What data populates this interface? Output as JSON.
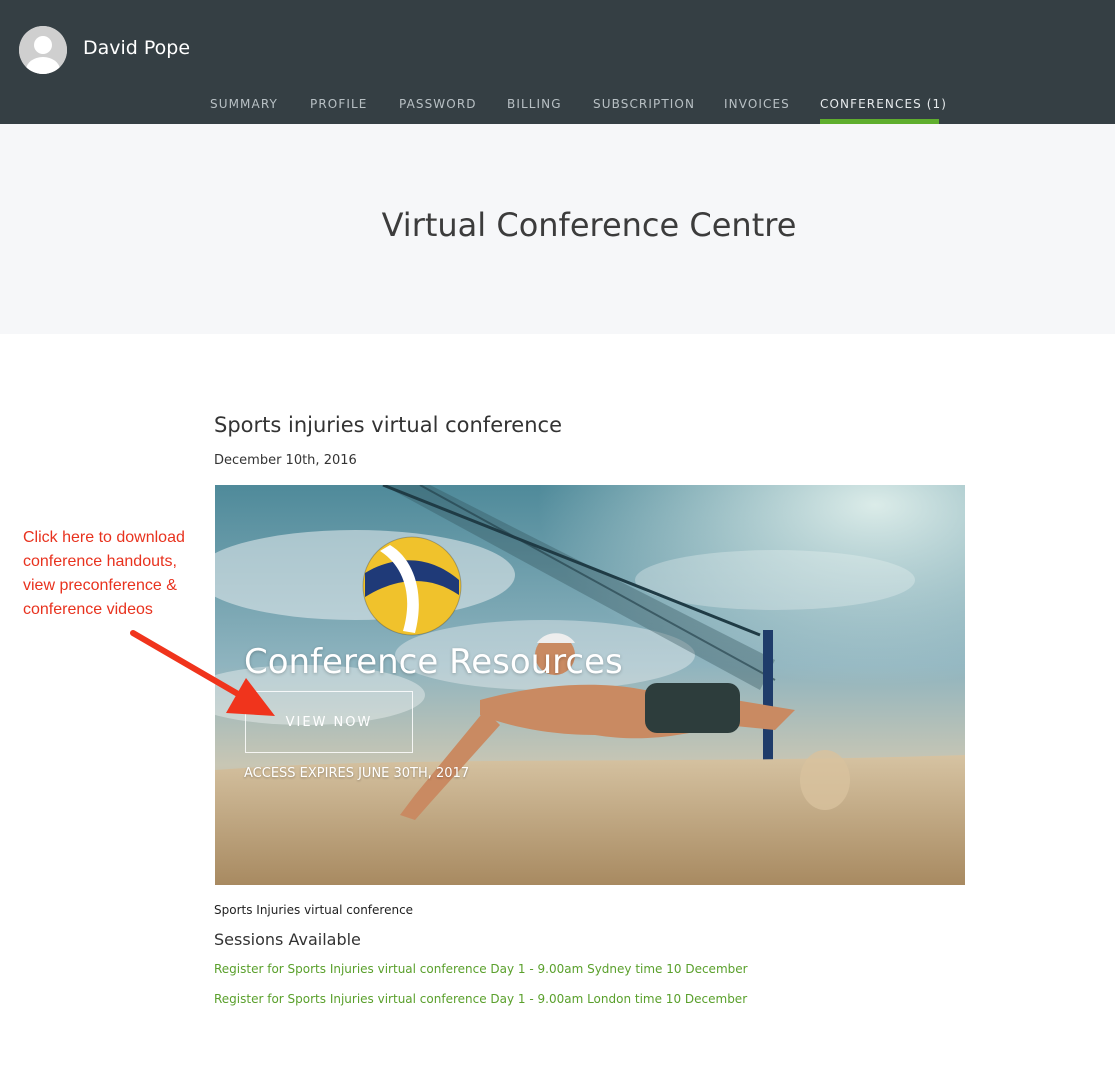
{
  "header": {
    "user_name": "David Pope",
    "avatar_icon": "user-avatar-icon",
    "bg_color": "#353f44",
    "accent_color": "#5fae2e",
    "nav": [
      {
        "label": "SUMMARY",
        "active": false
      },
      {
        "label": "PROFILE",
        "active": false
      },
      {
        "label": "PASSWORD",
        "active": false
      },
      {
        "label": "BILLING",
        "active": false
      },
      {
        "label": "SUBSCRIPTION",
        "active": false
      },
      {
        "label": "INVOICES",
        "active": false
      },
      {
        "label": "CONFERENCES (1)",
        "active": true
      }
    ]
  },
  "hero": {
    "title": "Virtual Conference Centre"
  },
  "conference": {
    "title": "Sports injuries virtual conference",
    "date": "December 10th, 2016",
    "banner": {
      "heading": "Conference Resources",
      "button_label": "VIEW NOW",
      "expires": "ACCESS EXPIRES JUNE 30TH, 2017"
    },
    "caption": "Sports Injuries virtual conference",
    "sessions_title": "Sessions Available",
    "sessions": [
      {
        "label": "Register for Sports Injuries virtual conference Day 1 - 9.00am Sydney time 10 December"
      },
      {
        "label": "Register for Sports Injuries virtual conference Day 1 - 9.00am London time 10 December"
      }
    ],
    "link_color": "#5aa02c"
  },
  "annotation": {
    "text_lines": [
      "Click here to download",
      "conference handouts,",
      "view preconference &",
      "conference videos"
    ],
    "color": "#e8321e"
  }
}
